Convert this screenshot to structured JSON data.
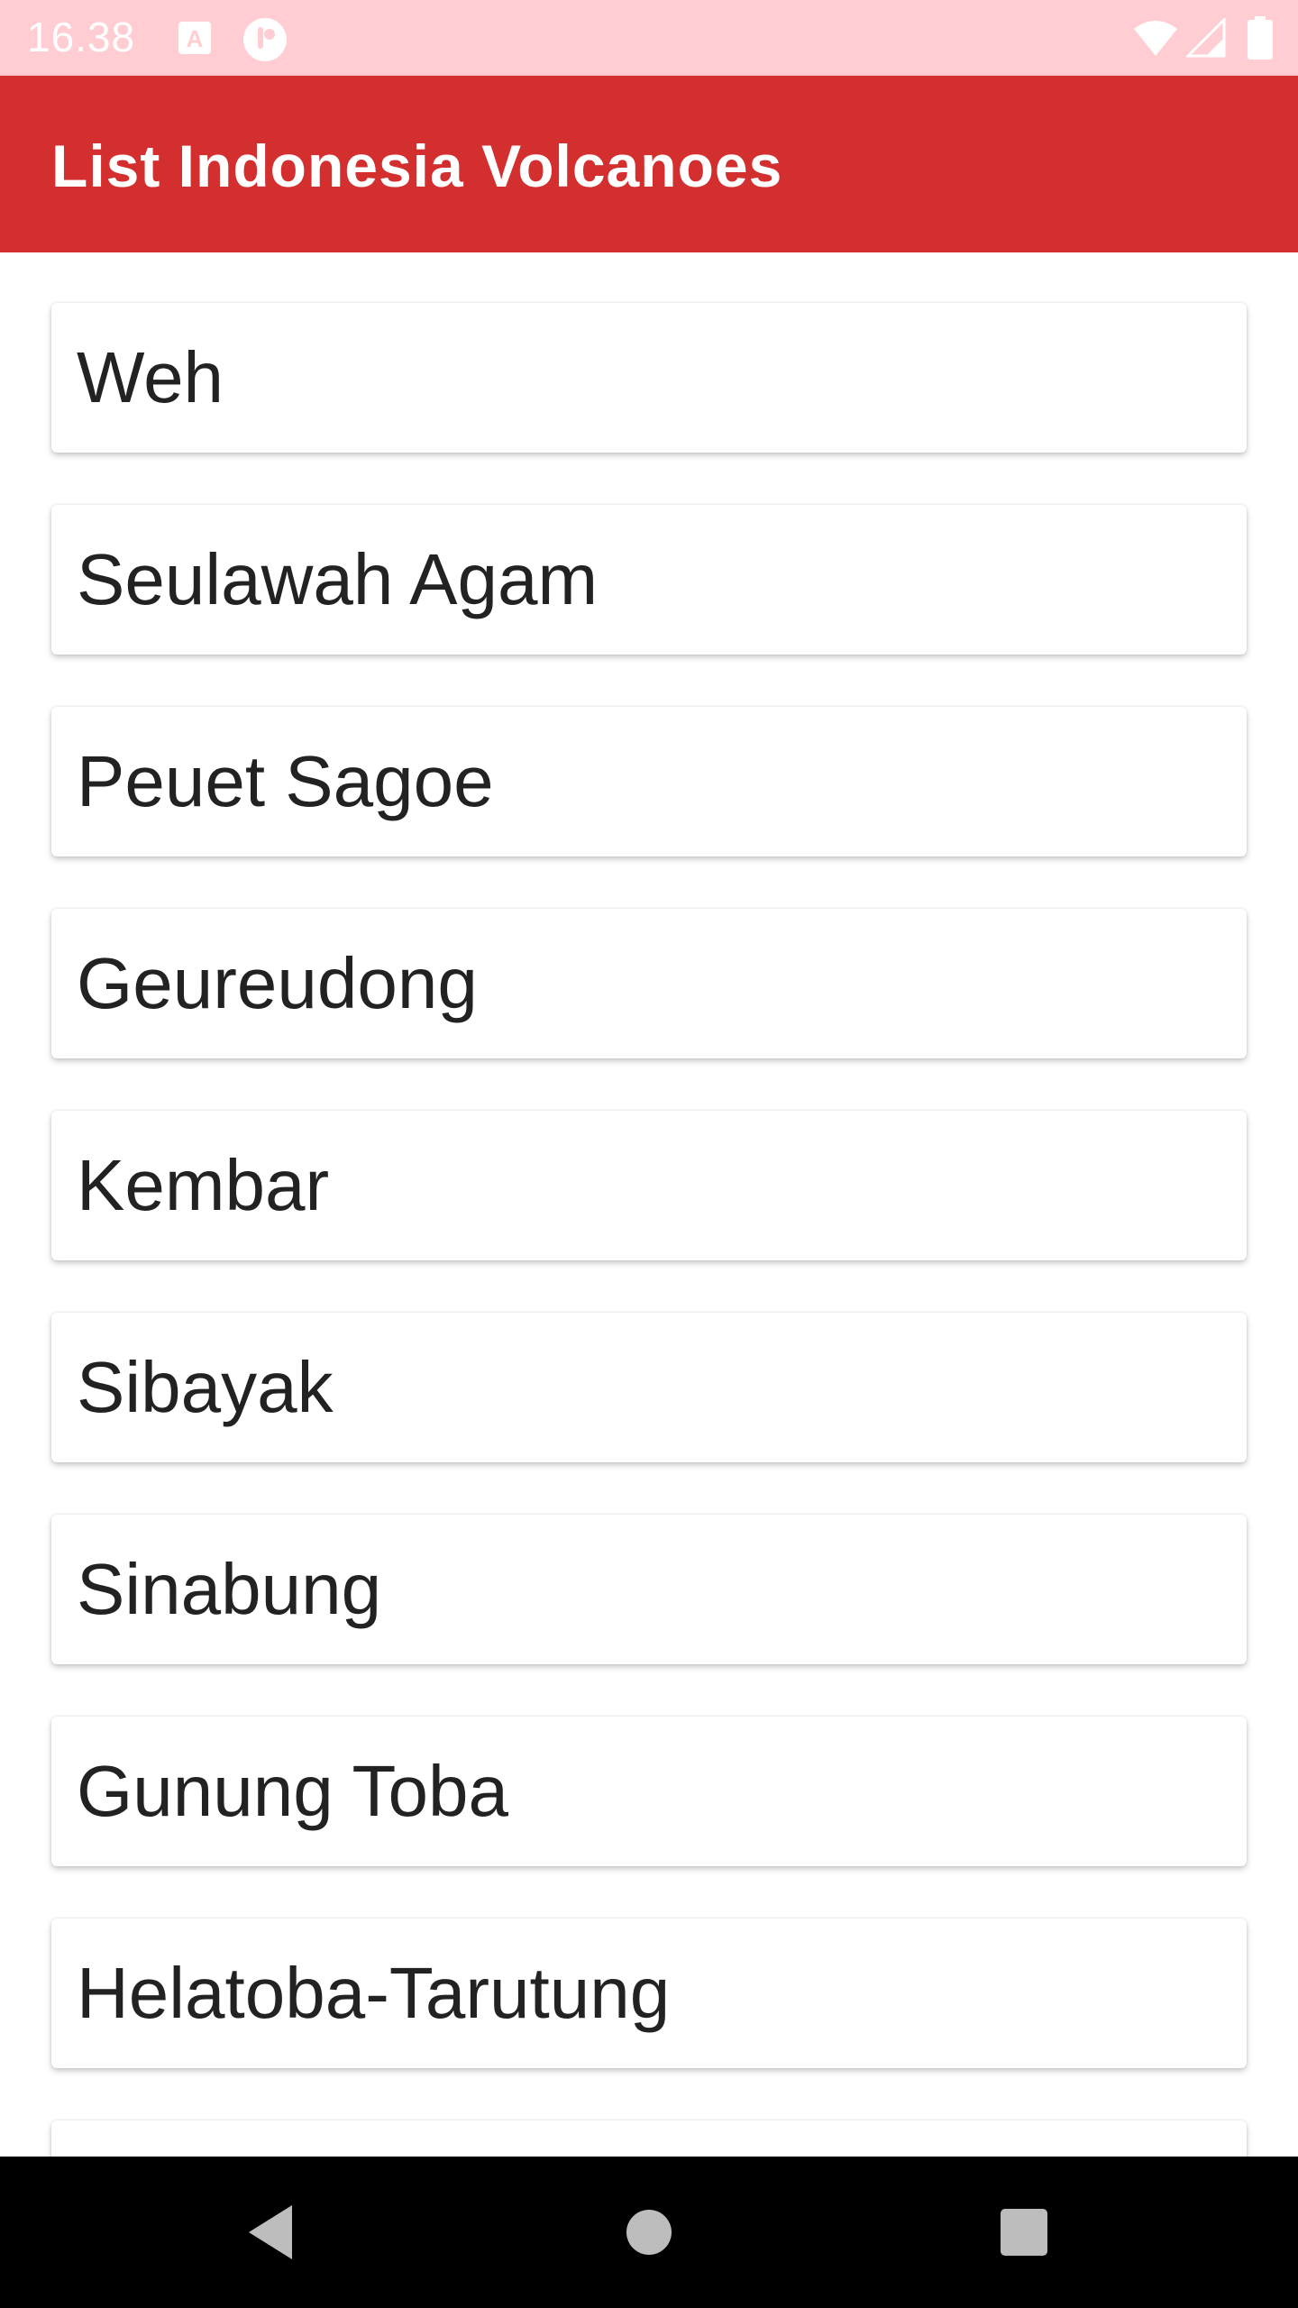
{
  "status_bar": {
    "time": "16.38",
    "icons": [
      "text-a-icon",
      "notification-icon",
      "wifi-icon",
      "signal-icon",
      "battery-icon"
    ]
  },
  "app_bar": {
    "title": "List Indonesia Volcanoes",
    "color": "#d32f2f"
  },
  "volcanoes": [
    "Weh",
    "Seulawah Agam",
    "Peuet Sagoe",
    "Geureudong",
    "Kembar",
    "Sibayak",
    "Sinabung",
    "Gunung Toba",
    "Helatoba-Tarutung"
  ],
  "nav_bar": {
    "icons": [
      "back-icon",
      "home-icon",
      "recents-icon"
    ]
  }
}
